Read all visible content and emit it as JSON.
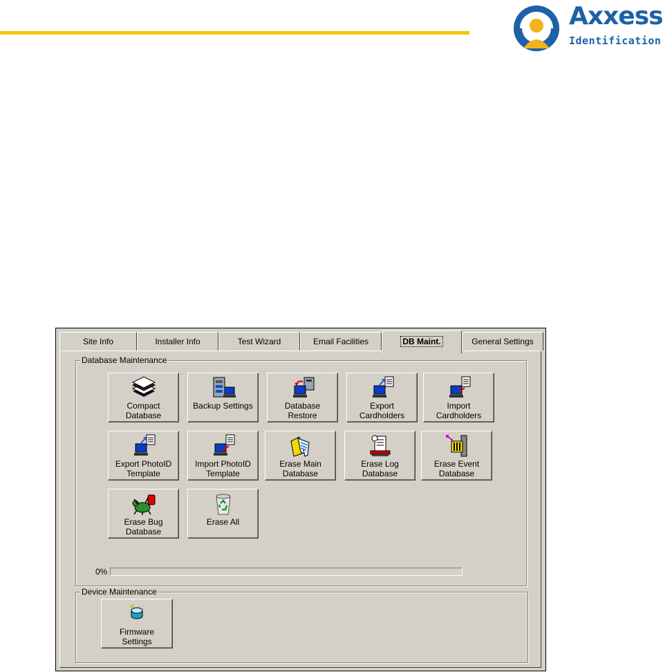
{
  "brand": {
    "name": "Axxess",
    "tagline": "Identification"
  },
  "tabs": [
    {
      "label": "Site Info",
      "active": false
    },
    {
      "label": "Installer Info",
      "active": false
    },
    {
      "label": "Test Wizard",
      "active": false
    },
    {
      "label": "Email Facilities",
      "active": false
    },
    {
      "label": "DB Maint.",
      "active": true
    },
    {
      "label": "General Settings",
      "active": false
    }
  ],
  "database_group": {
    "title": "Database Maintenance",
    "buttons": [
      {
        "label": "Compact\nDatabase",
        "icon": "stacked-papers-icon"
      },
      {
        "label": "Backup Settings",
        "icon": "server-backup-icon"
      },
      {
        "label": "Database\nRestore",
        "icon": "restore-computer-icon"
      },
      {
        "label": "Export\nCardholders",
        "icon": "export-computer-icon"
      },
      {
        "label": "Import\nCardholders",
        "icon": "import-computer-icon"
      },
      {
        "label": "Export PhotoID\nTemplate",
        "icon": "export-computer-icon"
      },
      {
        "label": "Import PhotoID\nTemplate",
        "icon": "import-computer-icon"
      },
      {
        "label": "Erase Main\nDatabase",
        "icon": "folder-erase-icon"
      },
      {
        "label": "Erase Log\nDatabase",
        "icon": "log-erase-icon"
      },
      {
        "label": "Erase Event\nDatabase",
        "icon": "event-erase-icon"
      },
      {
        "label": "Erase Bug\nDatabase",
        "icon": "bug-icon"
      },
      {
        "label": "Erase All",
        "icon": "recycle-bin-icon"
      }
    ],
    "progress": {
      "label": "0%",
      "value": 0
    }
  },
  "device_group": {
    "title": "Device Maintenance",
    "buttons": [
      {
        "label": "Firmware\nSettings",
        "icon": "firmware-chip-icon"
      }
    ]
  },
  "colors": {
    "brand_blue": "#1d62a8",
    "brand_yellow": "#f3c600",
    "dialog_face": "#d4d0c8"
  }
}
